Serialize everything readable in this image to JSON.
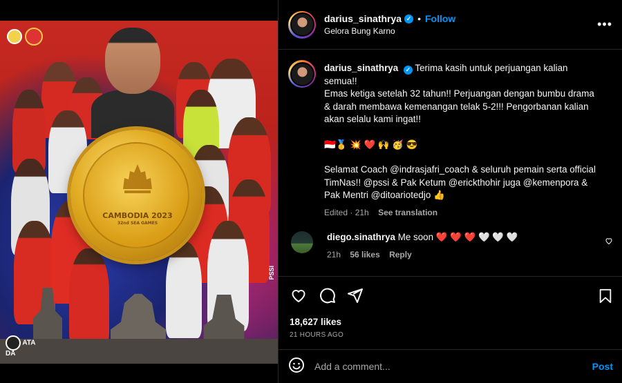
{
  "header": {
    "username": "darius_sinathrya",
    "follow_label": "Follow",
    "location": "Gelora Bung Karno",
    "more_label": "•••"
  },
  "poster": {
    "medal_title": "CAMBODIA 2023",
    "medal_subtitle": "32nd SEA GAMES",
    "side_text": "PSSI",
    "watermark": "ATA DA"
  },
  "caption": {
    "username": "darius_sinathrya",
    "text_line1": "Terima kasih untuk perjuangan kalian semua!!",
    "text_line2": "Emas ketiga setelah 32 tahun!! Perjuangan dengan bumbu drama & darah membawa kemenangan telak 5-2!!! Pengorbanan kalian akan selalu kami ingat!!",
    "emoji_line": "🇮🇩🥇 💥 ❤️ 🙌 🥳 😎",
    "text_line3": "Selamat Coach @indrasjafri_coach & seluruh pemain serta official TimNas!! @pssi & Pak Ketum @erickthohir juga @kemenpora & Pak Mentri @ditoariotedjo 👍",
    "edited": "Edited · 21h",
    "see_translation": "See translation"
  },
  "reply": {
    "username": "diego.sinathrya",
    "text": "Me soon ❤️ ❤️ ❤️ 🤍 🤍 🤍",
    "time": "21h",
    "likes": "56 likes",
    "reply_label": "Reply"
  },
  "actions": {
    "likes_count": "18,627 likes",
    "posted_time": "21 HOURS AGO"
  },
  "add_comment": {
    "placeholder": "Add a comment...",
    "post_label": "Post"
  },
  "colors": {
    "accent": "#0095f6",
    "background": "#000000",
    "muted": "#a8a8a8"
  }
}
